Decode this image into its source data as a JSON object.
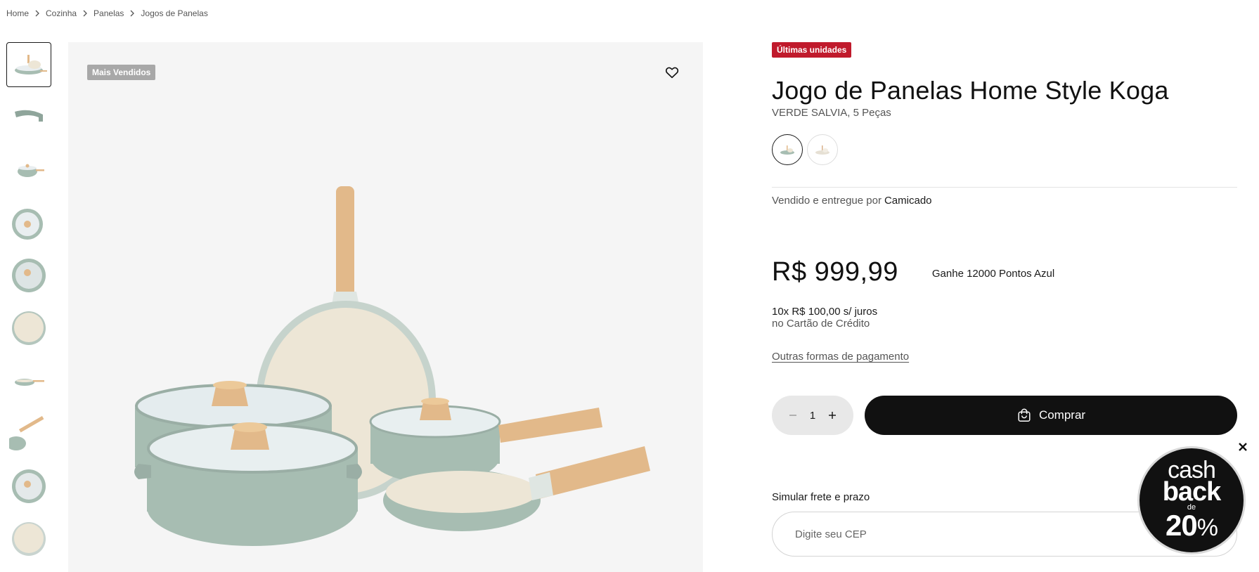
{
  "breadcrumb": {
    "items": [
      "Home",
      "Cozinha",
      "Panelas",
      "Jogos de Panelas"
    ]
  },
  "gallery": {
    "thumbnail_count": 10,
    "badge": "Mais Vendidos",
    "wishlist_icon": "heart-icon"
  },
  "product": {
    "stock_badge": "Últimas unidades",
    "title": "Jogo de Panelas Home Style Koga",
    "variant": "VERDE SALVIA, 5 Peças",
    "seller_prefix": "Vendido e entregue por",
    "seller_name": "Camicado",
    "price": "R$ 999,99",
    "points": "Ganhe 12000 Pontos Azul",
    "installments_main": "10x R$ 100,00 s/ juros",
    "installments_sub": "no Cartão de Crédito",
    "other_payments": "Outras formas de pagamento"
  },
  "purchase": {
    "quantity": "1",
    "buy_label": "Comprar"
  },
  "shipping": {
    "label": "Simular frete e prazo",
    "cep_placeholder": "Digite seu CEP"
  },
  "cashback": {
    "line1": "cash",
    "line2": "back",
    "line3": "de",
    "line4": "20",
    "percent": "%"
  },
  "colors": {
    "accent": "#111111",
    "stock_badge": "#c01a2c",
    "pan_green": "#a7bdb2",
    "pan_cream": "#ede6d6",
    "wood": "#e2b98a"
  }
}
